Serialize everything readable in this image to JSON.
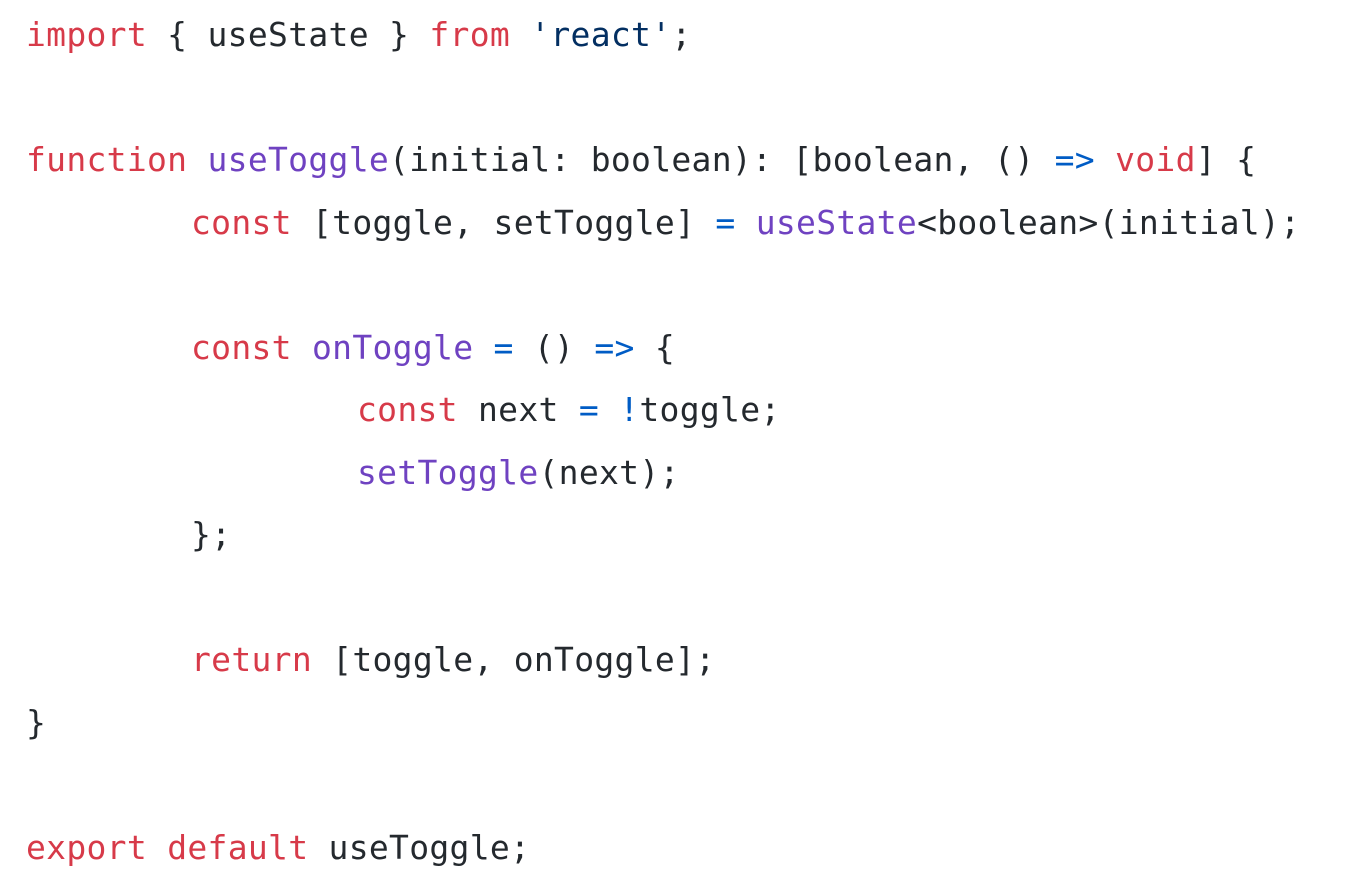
{
  "colors": {
    "keyword": "#d73a49",
    "function": "#6f42c1",
    "operator": "#005cc5",
    "string": "#032f62",
    "text": "#24292e",
    "background": "#ffffff"
  },
  "code": {
    "line1": {
      "t1": "import",
      "t2": " { useState } ",
      "t3": "from",
      "t4": " ",
      "t5": "'react'",
      "t6": ";"
    },
    "line3": {
      "t1": "function",
      "t2": " ",
      "t3": "useToggle",
      "t4": "(initial: boolean): [boolean, () ",
      "t5": "=>",
      "t6": " ",
      "t7": "void",
      "t8": "] {"
    },
    "line4": {
      "t1": "const",
      "t2": " [toggle, setToggle] ",
      "t3": "=",
      "t4": " ",
      "t5": "useState",
      "t6": "<boolean>(initial);"
    },
    "line6": {
      "t1": "const",
      "t2": " ",
      "t3": "onToggle",
      "t4": " ",
      "t5": "=",
      "t6": " () ",
      "t7": "=>",
      "t8": " {"
    },
    "line7": {
      "t1": "const",
      "t2": " next ",
      "t3": "=",
      "t4": " ",
      "t5": "!",
      "t6": "toggle;"
    },
    "line8": {
      "t1": "setToggle",
      "t2": "(next);"
    },
    "line9": {
      "t1": "};"
    },
    "line11": {
      "t1": "return",
      "t2": " [toggle, onToggle];"
    },
    "line12": {
      "t1": "}"
    },
    "line14": {
      "t1": "export",
      "t2": " ",
      "t3": "default",
      "t4": " useToggle;"
    }
  }
}
